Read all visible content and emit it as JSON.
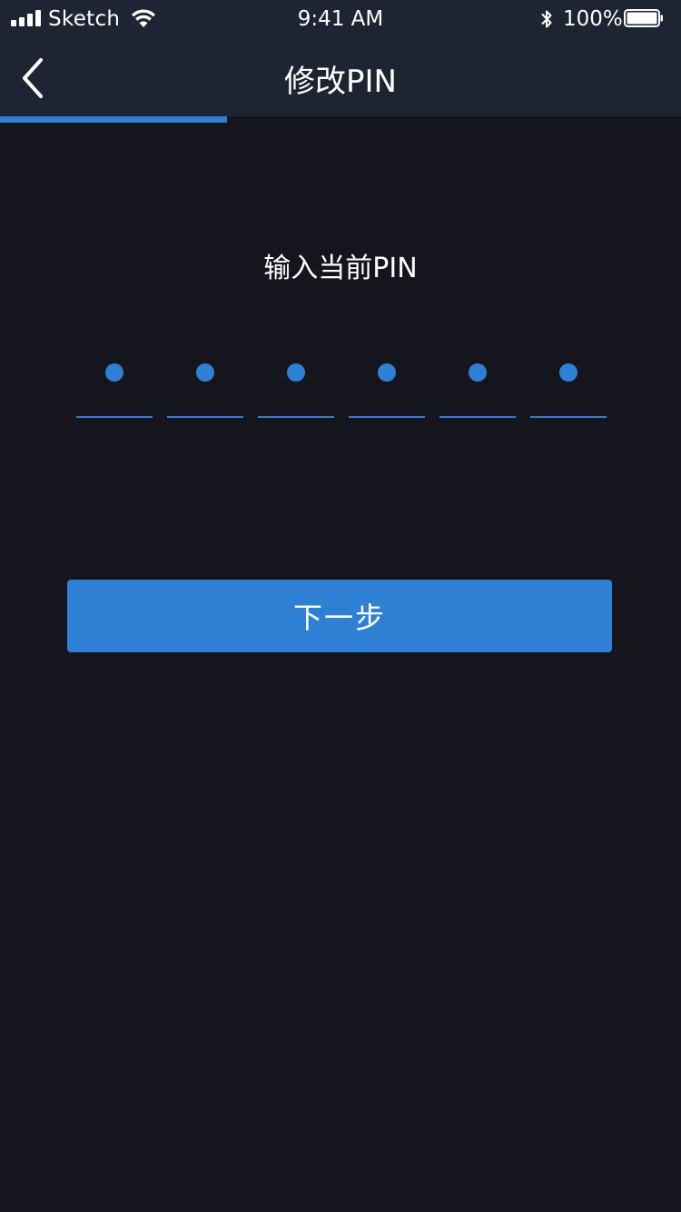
{
  "status_bar": {
    "carrier": "Sketch",
    "time": "9:41 AM",
    "battery": "100%"
  },
  "nav": {
    "title": "修改PIN",
    "back_icon": "chevron-left-icon"
  },
  "progress": {
    "fraction": 0.333
  },
  "pin": {
    "prompt": "输入当前PIN",
    "digits_total": 6,
    "digits_filled": 6
  },
  "actions": {
    "next_label": "下一步"
  },
  "colors": {
    "accent": "#2e80d5",
    "background": "#14151d",
    "header": "#1e2532"
  }
}
